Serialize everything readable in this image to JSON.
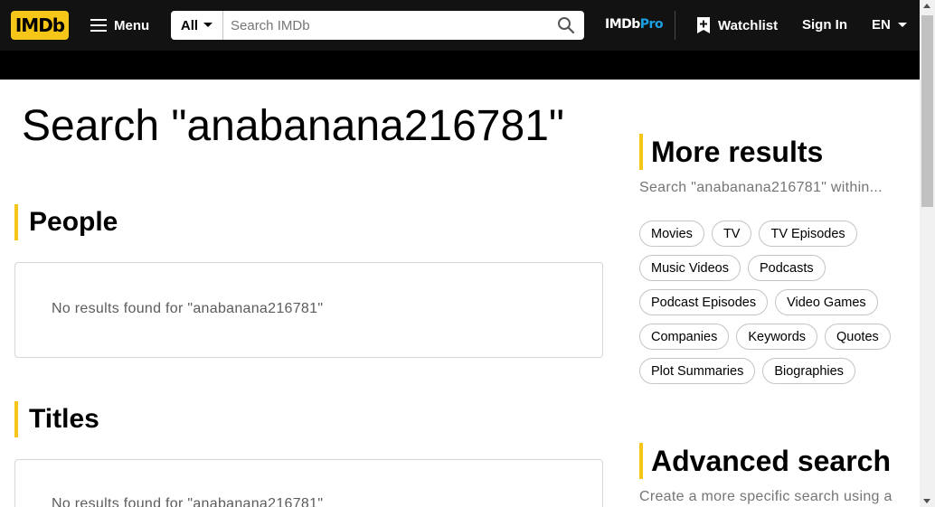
{
  "header": {
    "logo_text": "IMDb",
    "menu_label": "Menu",
    "search_category": "All",
    "search_placeholder": "Search IMDb",
    "pro_imdb": "IMDb",
    "pro_suffix": "Pro",
    "watchlist_label": "Watchlist",
    "signin_label": "Sign In",
    "language_label": "EN"
  },
  "main": {
    "title": "Search \"anabanana216781\"",
    "sections": [
      {
        "title": "People",
        "empty_text": "No results found for \"anabanana216781\""
      },
      {
        "title": "Titles",
        "empty_text": "No results found for \"anabanana216781\""
      }
    ]
  },
  "sidebar": {
    "more_results_title": "More results",
    "more_results_subtitle": "Search \"anabanana216781\" within...",
    "chips": [
      "Movies",
      "TV",
      "TV Episodes",
      "Music Videos",
      "Podcasts",
      "Podcast Episodes",
      "Video Games",
      "Companies",
      "Keywords",
      "Quotes",
      "Plot Summaries",
      "Biographies"
    ],
    "advanced_title": "Advanced search",
    "advanced_subtitle": "Create a more specific search using a"
  },
  "colors": {
    "brand_yellow": "#f5c518",
    "header_bg": "#121212",
    "pro_blue": "#1ba0e1"
  },
  "icons": [
    "hamburger-menu-icon",
    "caret-down-icon",
    "search-icon",
    "watchlist-add-icon"
  ]
}
